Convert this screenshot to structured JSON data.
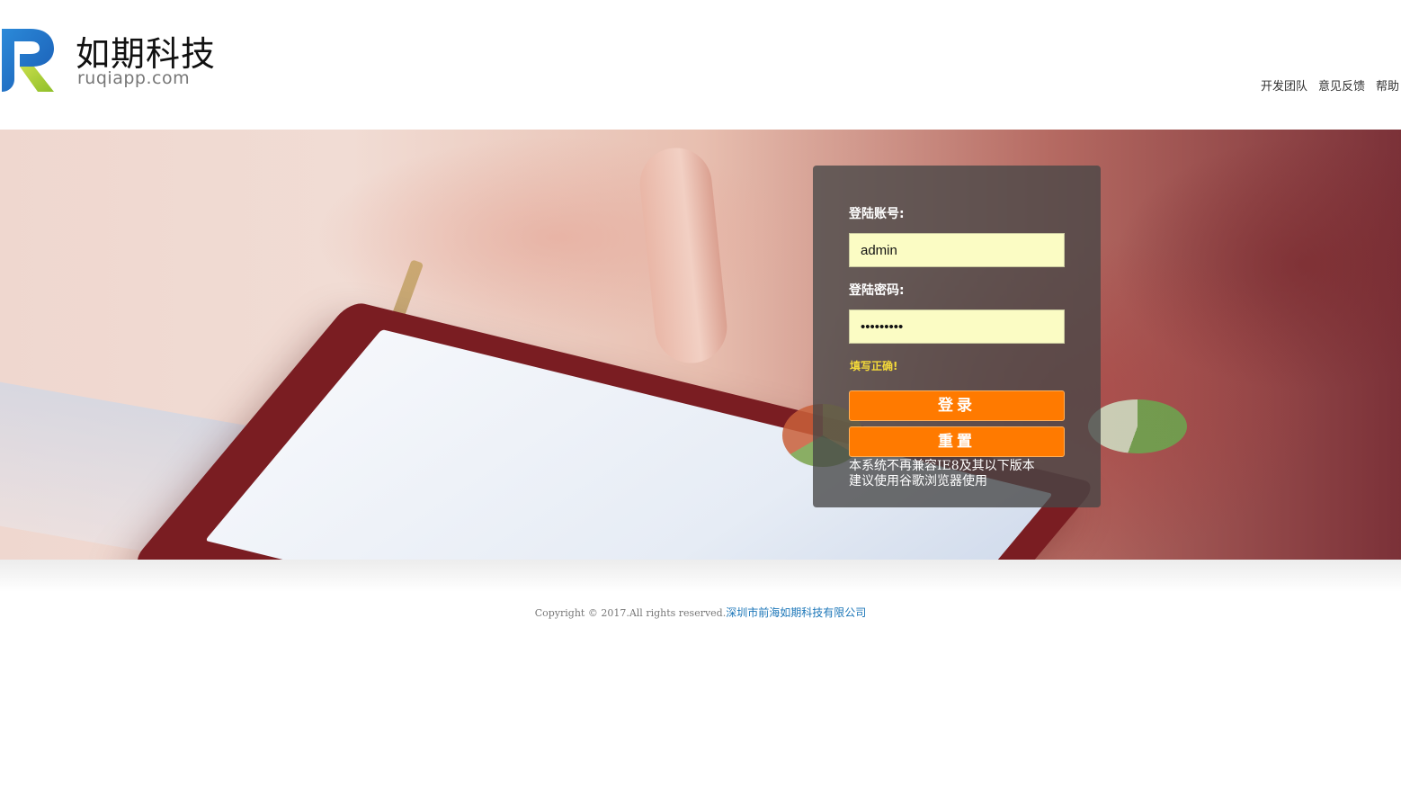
{
  "header": {
    "logo": {
      "cn_name": "如期科技",
      "domain": "ruqiapp.com"
    },
    "nav": [
      {
        "label": "开发团队"
      },
      {
        "label": "意见反馈"
      },
      {
        "label": "帮助"
      }
    ]
  },
  "login": {
    "account_label": "登陆账号:",
    "account_value": "admin",
    "password_label": "登陆密码:",
    "password_value": "123456789",
    "hint": "填写正确!",
    "login_button": "登录",
    "reset_button": "重置",
    "notice_line1": "本系统不再兼容IE8及其以下版本",
    "notice_line2": "建议使用谷歌浏览器使用"
  },
  "footer": {
    "copyright": "Copyright © 2017.All rights reserved.",
    "company": "深圳市前海如期科技有限公司"
  },
  "colors": {
    "accent_button": "#ff7a00",
    "input_bg": "#fbfcc4",
    "hint": "#f3d93a",
    "link": "#1b76b8"
  }
}
